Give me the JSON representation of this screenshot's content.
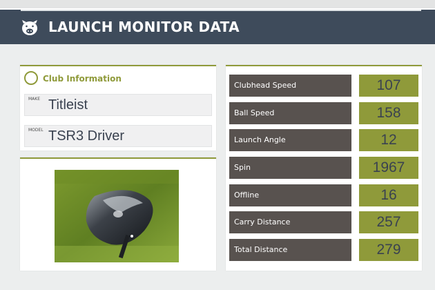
{
  "header": {
    "title": "LAUNCH MONITOR DATA",
    "logo_icon": "pig-logo-icon"
  },
  "club_info": {
    "title": "Club Information",
    "make_label": "MAKE",
    "make_value": "Titleist",
    "model_label": "MODEL",
    "model_value": "TSR3 Driver"
  },
  "stats": [
    {
      "label": "Clubhead Speed",
      "value": "107"
    },
    {
      "label": "Ball Speed",
      "value": "158"
    },
    {
      "label": "Launch Angle",
      "value": "12"
    },
    {
      "label": "Spin",
      "value": "1967"
    },
    {
      "label": "Offline",
      "value": "16"
    },
    {
      "label": "Carry Distance",
      "value": "257"
    },
    {
      "label": "Total Distance",
      "value": "279"
    }
  ],
  "colors": {
    "header_bg": "#3e4b5b",
    "accent": "#8f9a3a",
    "label_bg": "#58524f",
    "page_bg": "#eceeee"
  }
}
